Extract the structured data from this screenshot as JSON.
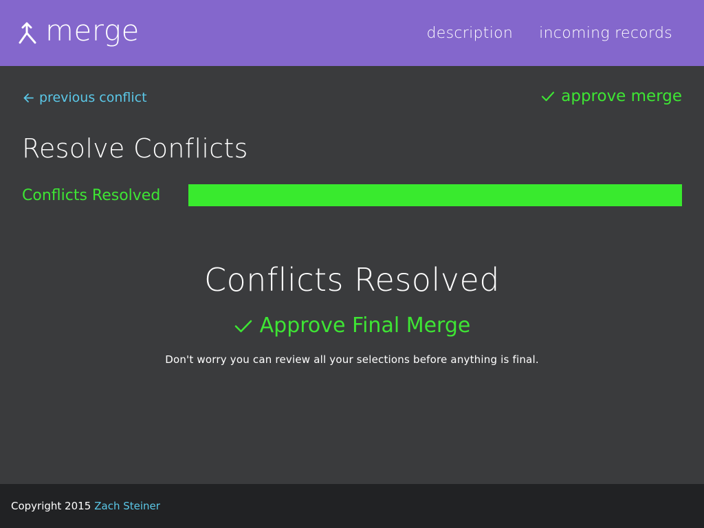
{
  "header": {
    "logo_text": "merge",
    "logo_icon": "merge-arrow-icon",
    "nav": [
      {
        "label": "description"
      },
      {
        "label": "incoming records"
      }
    ]
  },
  "toolbar": {
    "previous_label": "previous conflict",
    "previous_icon": "arrow-left-icon",
    "approve_label": "approve merge",
    "approve_icon": "check-icon"
  },
  "page_title": "Resolve Conflicts",
  "progress": {
    "label": "Conflicts Resolved",
    "percent": 100
  },
  "main": {
    "heading": "Conflicts Resolved",
    "approve_final_label": "Approve Final Merge",
    "note": "Don't worry you can review all your selections before anything is final."
  },
  "footer": {
    "copyright": "Copyright 2015",
    "author": "Zach Steiner"
  },
  "colors": {
    "header_bg": "#8467cc",
    "body_bg": "#3a3b3d",
    "footer_bg": "#212224",
    "accent_green": "#3ee534",
    "progress_fill": "#39ea2e",
    "link_blue": "#5bc8e8"
  }
}
